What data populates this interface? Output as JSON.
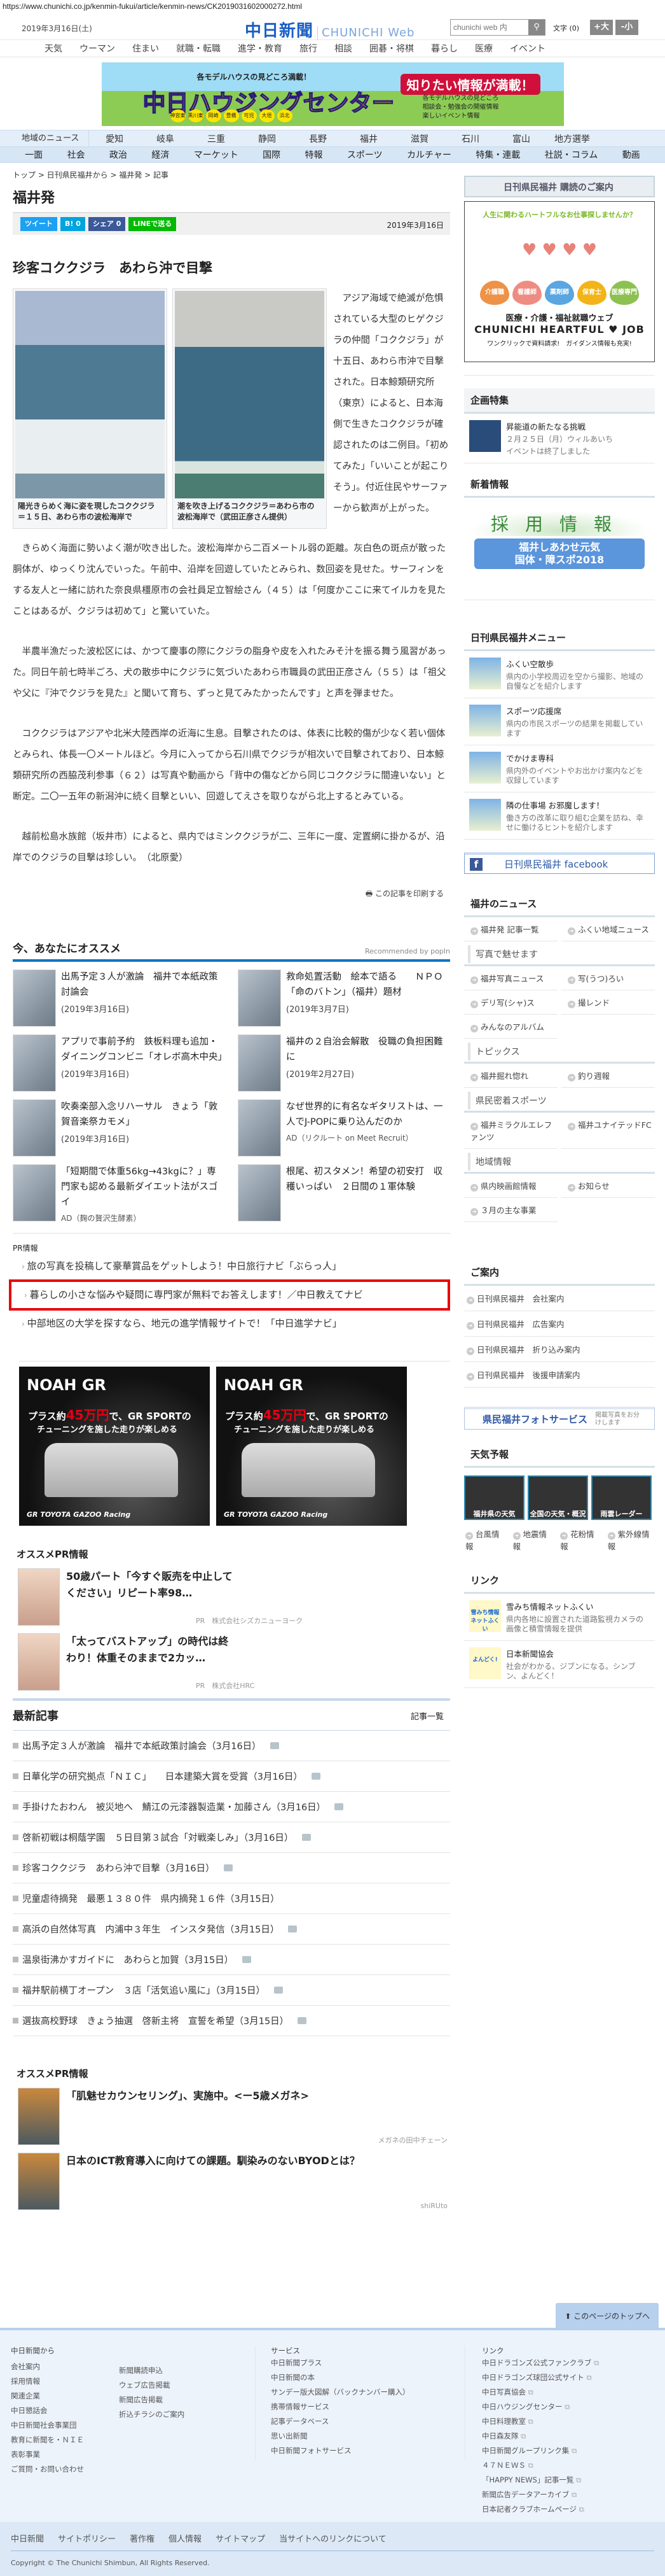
{
  "url": "https://www.chunichi.co.jp/kenmin-fukui/article/kenmin-news/CK2019031602000272.html",
  "header": {
    "date": "2019年3月16日(土)",
    "logo": "中日新聞",
    "logo_sub": "CHUNICHI Web",
    "search_placeholder": "chunichi web 内",
    "font_label": "文字 (0)",
    "font_up": "+大",
    "font_down": "-小"
  },
  "global_nav": [
    "天気",
    "ウーマン",
    "住まい",
    "就職・転職",
    "進学・教育",
    "旅行",
    "相談",
    "囲碁・将棋",
    "暮らし",
    "医療",
    "イベント"
  ],
  "banner": {
    "top": "各モデルハウスの見どころ満載！",
    "title": "中日ハウジングセンター",
    "badge": "知りたい情報が満載！",
    "points": [
      "各モデルハウスの見どころ",
      "相談会・勉強会の開催情報",
      "楽しいイベント情報"
    ],
    "places": [
      "神宮東",
      "黒川東",
      "岡崎",
      "豊橋",
      "可児",
      "大垣",
      "浜北"
    ]
  },
  "region_nav": {
    "label": "地域のニュース",
    "items": [
      "愛知",
      "岐阜",
      "三重",
      "静岡",
      "長野",
      "福井",
      "滋賀",
      "石川",
      "富山",
      "地方選挙"
    ]
  },
  "category_nav": [
    "一面",
    "社会",
    "政治",
    "経済",
    "マーケット",
    "国際",
    "特報",
    "スポーツ",
    "カルチャー",
    "特集・連載",
    "社説・コラム",
    "動画"
  ],
  "breadcrumb": "トップ > 日刊県民福井から > 福井発 > 記事",
  "section_title": "福井発",
  "share": {
    "tweet": "ツイート",
    "hatena": "B! 0",
    "facebook": "シェア 0",
    "line": "LINEで送る",
    "date": "2019年3月16日"
  },
  "article": {
    "title": "珍客コククジラ　あわら沖で目撃",
    "captions": [
      "陽光きらめく海に姿を現したコククジラ＝１５日、あわら市の波松海岸で",
      "潮を吹き上げるコククジラ＝あわら市の波松海岸で（武田正彦さん提供）"
    ],
    "paragraphs": [
      "アジア海域で絶滅が危惧されている大型のヒゲクジラの仲間「コククジラ」が十五日、あわら市沖で目撃された。日本鯨類研究所（東京）によると、日本海側で生きたコククジラが確認されたのは二例目。「初めてみた」「いいことが起こりそう」。付近住民やサーファーから歓声が上がった。",
      "きらめく海面に勢いよく潮が吹き出した。波松海岸から二百メートル弱の距離。灰白色の斑点が散った胴体が、ゆっくり沈んでいった。午前中、沿岸を回遊していたとみられ、数回姿を見せた。サーフィンをする友人と一緒に訪れた奈良県橿原市の会社員足立智絵さん（４５）は「何度かここに来てイルカを見たことはあるが、クジラは初めて」と驚いていた。",
      "半農半漁だった波松区には、かつて慶事の際にクジラの脂身や皮を入れたみそ汁を振る舞う風習があった。同日午前七時半ごろ、犬の散歩中にクジラに気づいたあわら市職員の武田正彦さん（５５）は「祖父や父に『沖でクジラを見た』と聞いて育ち、ずっと見てみたかったんです」と声を弾ませた。",
      "コククジラはアジアや北米大陸西岸の近海に生息。目撃されたのは、体表に比較的傷が少なく若い個体とみられ、体長一〇メートルほど。今月に入ってから石川県でクジラが相次いで目撃されており、日本鯨類研究所の西脇茂利参事（６２）は写真や動画から「背中の傷などから同じコククジラに間違いない」と断定。二〇一五年の新潟沖に続く目撃といい、回遊してえさを取りながら北上するとみている。",
      "越前松島水族館（坂井市）によると、県内ではミンククジラが二、三年に一度、定置網に掛かるが、沿岸でのクジラの目撃は珍しい。　（北原愛）"
    ],
    "print": "この記事を印刷する"
  },
  "recommend": {
    "title": "今、あなたにオススメ",
    "by": "Recommended by popIn",
    "items": [
      {
        "title": "出馬予定３人が激論　福井で本紙政策討論会",
        "date": "(2019年3月16日)"
      },
      {
        "title": "救命処置活動　絵本で語る　　ＮＰＯ「命のバトン」（福井）題材",
        "date": "(2019年3月7日)"
      },
      {
        "title": "アプリで事前予約　鉄板料理も追加・ダイニングコンビニ「オレボ高木中央」",
        "date": "(2019年3月16日)"
      },
      {
        "title": "福井の２自治会解散　役職の負担困難に",
        "date": "(2019年2月27日)"
      },
      {
        "title": "吹奏楽部入念リハーサル　きょう「敦賀音楽祭カモメ」",
        "date": "(2019年3月16日)"
      },
      {
        "title": "なぜ世界的に有名なギタリストは、一人でJ-POPに乗り込んだのか",
        "ad": "AD（リクルート on Meet Recruit）"
      },
      {
        "title": "「短期間で体重56kg→43kgに？」専門家も認める最新ダイエット法がスゴイ",
        "ad": "AD（麹の贅沢生酵素）"
      },
      {
        "title": "根尾、初スタメン！希望の初安打　収穫いっぱい　２日間の１軍体験"
      }
    ]
  },
  "pr": {
    "label": "PR情報",
    "items": [
      "旅の写真を投稿して豪華賞品をゲットしよう！中日旅行ナビ「ぶらっ人」",
      "暮らしの小さな悩みや疑問に専門家が無料でお答えします！／中日教えてナビ",
      "中部地区の大学を探すなら、地元の進学情報サイトで！「中日進学ナビ」"
    ]
  },
  "car_ad": {
    "name": "NOAH GR",
    "line1a": "プラス約",
    "price": "45万円",
    "line1b": "で、GR SPORTの",
    "line2": "チューニングを施した走りが楽しめる",
    "brand": "GR TOYOTA GAZOO Racing"
  },
  "oss1": {
    "title": "オススメPR情報",
    "items": [
      {
        "title": "50歳パート「今すぐ販売を中止してください」リピート率98…",
        "src": "PR　株式会社シズカニューヨーク"
      },
      {
        "title": "「太ってバストアップ」の時代は終わり！体重そのままで2カッ…",
        "src": "PR　株式会社HRC"
      }
    ]
  },
  "latest": {
    "title": "最新記事",
    "more": "記事一覧",
    "items": [
      "出馬予定３人が激論　福井で本紙政策討論会（3月16日）",
      "日華化学の研究拠点「ＮＩＣ」　　日本建築大賞を受賞（3月16日）",
      "手掛けたおわん　被災地へ　鯖江の元漆器製造業・加藤さん（3月16日）",
      "啓新初戦は桐蔭学園　５日目第３試合「対戦楽しみ」（3月16日）",
      "珍客コククジラ　あわら沖で目撃（3月16日）",
      "児童虐待摘発　最悪１３８０件　県内摘発１６件（3月15日）",
      "高浜の自然体写真　内浦中３年生　インスタ発信（3月15日）",
      "温泉街沸かすガイドに　あわらと加賀（3月15日）",
      "福井駅前横丁オープン　３店「活気追い風に」（3月15日）",
      "選抜高校野球　きょう抽選　啓新主将　宣誓を希望（3月15日）"
    ],
    "camera": [
      true,
      true,
      true,
      true,
      true,
      false,
      true,
      true,
      true,
      true
    ]
  },
  "oss2": {
    "title": "オススメPR情報",
    "items": [
      {
        "title": "「肌魅せカウンセリング」、実施中。<ー5歳メガネ>",
        "src": "メガネの田中チェーン"
      },
      {
        "title": "日本のICT教育導入に向けての課題。馴染みのないBYODとは？",
        "src": "shiRUto"
      }
    ]
  },
  "sidebar": {
    "subscribe": "日刊県民福井 購読のご案内",
    "heartful": {
      "q": "人生に関わるハートフルなお仕事探しませんか？",
      "jobs": [
        "介護職",
        "看護師",
        "薬剤師",
        "保育士",
        "医療専門職"
      ],
      "web": "医療・介護・福祉就職ウェブ",
      "name": "CHUNICHI HEARTFUL ♥ JOB",
      "f1": "ワンクリックで資料請求!",
      "f2": "ガイダンス情報も充実!"
    },
    "kikaku": {
      "title": "企画特集",
      "item": "昇能道の新たなる挑戦",
      "d1": "２月２５日（月）ウィルあいち",
      "d2": "イベントは終了しました"
    },
    "shinchaku": {
      "title": "新着情報",
      "a": "採用情報",
      "b": "福井しあわせ元気",
      "c": "国体・障スポ2018"
    },
    "menu": {
      "title": "日刊県民福井メニュー",
      "items": [
        {
          "t": "ふくい空散歩",
          "d": "県内の小学校周辺を空から撮影、地域の自慢などを紹介します"
        },
        {
          "t": "スポーツ応援席",
          "d": "県内の市民スポーツの結果を掲載しています"
        },
        {
          "t": "でかけま専科",
          "d": "県内外のイベントやお出かけ案内などを収録しています"
        },
        {
          "t": "隣の仕事場 お邪魔します！",
          "d": "働き方の改革に取り組む企業を訪ね、幸せに働けるヒントを紹介します"
        }
      ]
    },
    "facebook": "日刊県民福井 facebook",
    "news": {
      "title": "福井のニュース",
      "top": [
        "福井発 記事一覧",
        "ふくい地域ニュース"
      ],
      "s1": "写真で魅せます",
      "l1": [
        "福井写真ニュース",
        "写(うつ)ろい",
        "デリ写(シャ)ス",
        "撮レンド",
        "みんなのアルバム"
      ],
      "s2": "トピックス",
      "l2": [
        "福井掘れ惚れ",
        "釣り週報"
      ],
      "s3": "県民密着スポーツ",
      "l3": [
        "福井ミラクルエレファンツ",
        "福井ユナイテッドFC"
      ],
      "s4": "地域情報",
      "l4": [
        "県内映画館情報",
        "お知らせ",
        "３月の主な事業"
      ]
    },
    "guide": {
      "title": "ご案内",
      "items": [
        "日刊県民福井　会社案内",
        "日刊県民福井　広告案内",
        "日刊県民福井　折り込み案内",
        "日刊県民福井　後援申請案内"
      ]
    },
    "photo": {
      "name": "県民福井フォトサービス",
      "desc": "掲載写真をお分けします"
    },
    "weather": {
      "title": "天気予報",
      "tiles": [
        "福井県の天気",
        "全国の天気・概況",
        "雨雲レーダー"
      ],
      "links": [
        "台風情報",
        "地震情報",
        "花粉情報",
        "紫外線情報"
      ]
    },
    "links": {
      "title": "リンク",
      "items": [
        {
          "t": "雪みち情報ネットふくい",
          "d": "県内各地に設置された道路監視カメラの画像と積雪情報を提供",
          "img": "雪みち情報ネットふくい"
        },
        {
          "t": "日本新聞協会",
          "d": "社会がわかる、ジブンになる。シンブン、よんどく！",
          "img": "よんどく!"
        }
      ]
    }
  },
  "pagetop": "このページのトップへ",
  "footer": {
    "c1": {
      "h": "中日新聞から",
      "a": [
        "会社案内",
        "採用情報",
        "関連企業",
        "中日懇話会",
        "中日新聞社会事業団",
        "教育に新聞を・ＮＩＥ",
        "表彰事業",
        "ご質問・お問い合わせ"
      ],
      "b": [
        "新聞購読申込",
        "ウェブ広告掲載",
        "新聞広告掲載",
        "折込チラシのご案内"
      ]
    },
    "c2": {
      "h": "サービス",
      "a": [
        "中日新聞プラス",
        "中日新聞の本",
        "サンデー版大図解（バックナンバー購入）",
        "携帯情報サービス",
        "記事データベース",
        "思い出新聞",
        "中日新聞フォトサービス"
      ]
    },
    "c3": {
      "h": "リンク",
      "a": [
        "中日ドラゴンズ公式ファンクラブ",
        "中日ドラゴンズ球団公式サイト",
        "中日写真協会",
        "中日ハウジングセンター",
        "中日料理教室",
        "中日森友隊",
        "中日新聞グループリンク集",
        "４７ＮＥＷＳ",
        "「HAPPY NEWS」記事一覧",
        "新聞広告データアーカイブ",
        "日本記者クラブホームページ"
      ]
    },
    "bottom": [
      "中日新聞",
      "サイトポリシー",
      "著作権",
      "個人情報",
      "サイトマップ",
      "当サイトへのリンクについて"
    ],
    "copyright": "Copyright © The Chunichi Shimbun, All Rights Reserved."
  }
}
